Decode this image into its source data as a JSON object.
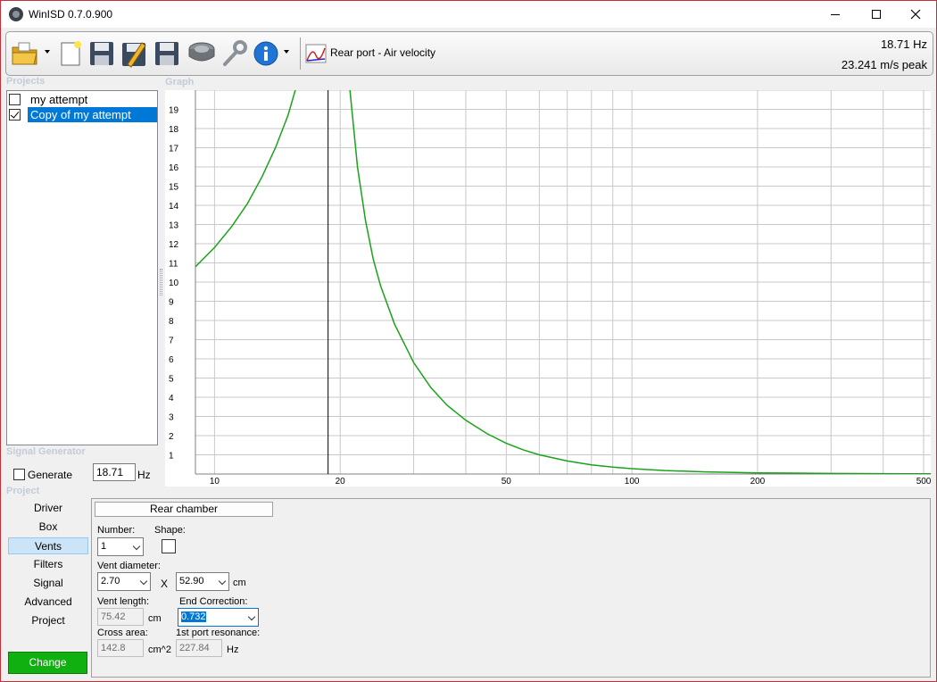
{
  "window": {
    "title": "WinISD 0.7.0.900"
  },
  "toolbar": {
    "graph_mode": "Rear port - Air velocity",
    "readout_freq": "18.71 Hz",
    "readout_velocity": "23.241 m/s peak"
  },
  "captions": {
    "projects": "Projects",
    "graph": "Graph",
    "signal_generator": "Signal Generator",
    "project": "Project"
  },
  "projects": [
    {
      "name": "my attempt",
      "checked": false,
      "selected": false
    },
    {
      "name": "Copy of my attempt",
      "checked": true,
      "selected": true
    }
  ],
  "signal_generator": {
    "generate_label": "Generate",
    "frequency": "18.71",
    "unit": "Hz",
    "checked": false
  },
  "tabs": [
    {
      "label": "Driver",
      "active": false
    },
    {
      "label": "Box",
      "active": false
    },
    {
      "label": "Vents",
      "active": true
    },
    {
      "label": "Filters",
      "active": false
    },
    {
      "label": "Signal",
      "active": false
    },
    {
      "label": "Advanced",
      "active": false
    },
    {
      "label": "Project",
      "active": false
    }
  ],
  "change_button": "Change",
  "vents": {
    "rear_chamber": "Rear chamber",
    "number_label": "Number:",
    "number_value": "1",
    "shape_label": "Shape:",
    "diameter_label": "Vent diameter:",
    "diameter_value": "2.70",
    "times": "X",
    "second_value": "52.90",
    "cm": "cm",
    "length_label": "Vent length:",
    "length_value": "75.42",
    "length_unit": "cm",
    "end_correction_label": "End Correction:",
    "end_correction_value": "0.732",
    "cross_area_label": "Cross area:",
    "cross_area_value": "142.8",
    "cross_area_unit": "cm^2",
    "port_res_label": "1st port resonance:",
    "port_res_value": "227.84",
    "port_res_unit": "Hz"
  },
  "chart_data": {
    "type": "line",
    "xscale": "log",
    "xlim": [
      9,
      520
    ],
    "ylim": [
      0,
      20
    ],
    "xticks": [
      10,
      20,
      50,
      100,
      200,
      500
    ],
    "yticks": [
      1,
      2,
      3,
      4,
      5,
      6,
      7,
      8,
      9,
      10,
      11,
      12,
      13,
      14,
      15,
      16,
      17,
      18,
      19
    ],
    "grid": true,
    "cursor_x": 18.71,
    "line_color": "#1aa31a",
    "series": [
      {
        "x": [
          9,
          10,
          11,
          12,
          13,
          14,
          15,
          16,
          17,
          18.5,
          19.5,
          20.5,
          21,
          22,
          23,
          24,
          25,
          27,
          30,
          33,
          36,
          40,
          45,
          50,
          55,
          60,
          70,
          80,
          90,
          100,
          120,
          150,
          200,
          300,
          400,
          520
        ],
        "y": [
          10.8,
          11.8,
          12.9,
          14.1,
          15.5,
          17.0,
          18.7,
          20.8,
          23.3,
          29,
          32,
          24.0,
          20.5,
          16.0,
          13.2,
          11.2,
          9.8,
          7.8,
          5.8,
          4.5,
          3.6,
          2.8,
          2.1,
          1.6,
          1.25,
          1.0,
          0.68,
          0.48,
          0.36,
          0.28,
          0.18,
          0.11,
          0.06,
          0.03,
          0.02,
          0.01
        ]
      }
    ]
  }
}
